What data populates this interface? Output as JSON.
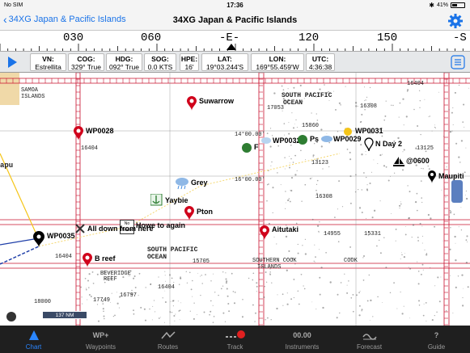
{
  "status_bar": {
    "carrier": "No SIM",
    "time": "17:36",
    "battery_text": "41%",
    "battery_level": 0.41
  },
  "nav": {
    "back_label": "34XG Japan & Pacific Islands",
    "title": "34XG Japan & Pacific Islands"
  },
  "compass": {
    "labels": [
      "030",
      "060",
      "-E-",
      "120",
      "150",
      "-S"
    ]
  },
  "info": [
    {
      "label": "VN:",
      "value": "Estrellita"
    },
    {
      "label": "COG:",
      "value": "329° True"
    },
    {
      "label": "HDG:",
      "value": "092° True"
    },
    {
      "label": "SOG:",
      "value": "0.0 KTS"
    },
    {
      "label": "HPE:",
      "value": "16'"
    },
    {
      "label": "LAT:",
      "value": "19°03.244'S"
    },
    {
      "label": "LON:",
      "value": "169°55.459'W"
    },
    {
      "label": "UTC:",
      "value": "4:36:38"
    }
  ],
  "map": {
    "waypoints": [
      {
        "name": "Suwarrow",
        "color": "#d0021b"
      },
      {
        "name": "WP0028",
        "color": "#d0021b"
      },
      {
        "name": "Grey",
        "color": "#4a90e2"
      },
      {
        "name": "Yaybie",
        "color": "#2e7d32"
      },
      {
        "name": "Pton",
        "color": "#d0021b"
      },
      {
        "name": "Howe to again",
        "color": "#333"
      },
      {
        "name": "All down from here",
        "color": "#333"
      },
      {
        "name": "WP0035",
        "color": "#000"
      },
      {
        "name": "Aitutaki",
        "color": "#d0021b"
      },
      {
        "name": "B reef",
        "color": "#d0021b"
      },
      {
        "name": "WP0032",
        "color": "#2e7d32"
      },
      {
        "name": "Ps",
        "color": "#2e7d32"
      },
      {
        "name": "WP0031",
        "color": "#f5c518"
      },
      {
        "name": "WP0029",
        "color": "#4a90e2"
      },
      {
        "name": "N Day 2",
        "color": "#000"
      },
      {
        "name": "@0600",
        "color": "#000"
      },
      {
        "name": "Maupiti",
        "color": "#000"
      },
      {
        "name": "F",
        "color": "#2e7d32"
      }
    ],
    "chart_texts": {
      "south_pacific_1": "SOUTH PACIFIC",
      "ocean_1": "OCEAN",
      "south_pacific_2": "SOUTH PACIFIC",
      "ocean_2": "OCEAN",
      "samoa": "SAMOA",
      "islands": "ISLANDS",
      "apu": "apu",
      "coord_1": "14°00.00'",
      "coord_2": "16°00.00'",
      "beveridge": "BEVERIDGE",
      "reef": "REEF",
      "cook": "COOK",
      "southern_cook": "SOUTHERN COOK",
      "islands_2": "ISLANDS",
      "now_label": "No Wake",
      "d1": "16404",
      "d2": "16308",
      "d3": "16404",
      "d4": "17053",
      "d5": "15860",
      "d6": "13123",
      "d7": "16308",
      "d8": "18000",
      "d9": "14955",
      "d10": "13125",
      "d11": "16404",
      "d12": "15331",
      "d13": "17749",
      "d14": "16797",
      "d15": "16404",
      "d16": "15705"
    },
    "scale": "137 NM"
  },
  "tabs": [
    {
      "label": "Chart",
      "icon": "chart-arrow-icon"
    },
    {
      "label": "Waypoints",
      "icon": "WP+"
    },
    {
      "label": "Routes",
      "icon": "routes-icon"
    },
    {
      "label": "Track",
      "icon": "track-icon"
    },
    {
      "label": "Instruments",
      "icon": "00.00"
    },
    {
      "label": "Forecast",
      "icon": "forecast-icon"
    },
    {
      "label": "Guide",
      "icon": "?"
    }
  ],
  "colors": {
    "accent": "#1a73e8",
    "tab_active": "#2a86ff",
    "chart_line": "#c8102e",
    "land": "#f0d9a8"
  }
}
